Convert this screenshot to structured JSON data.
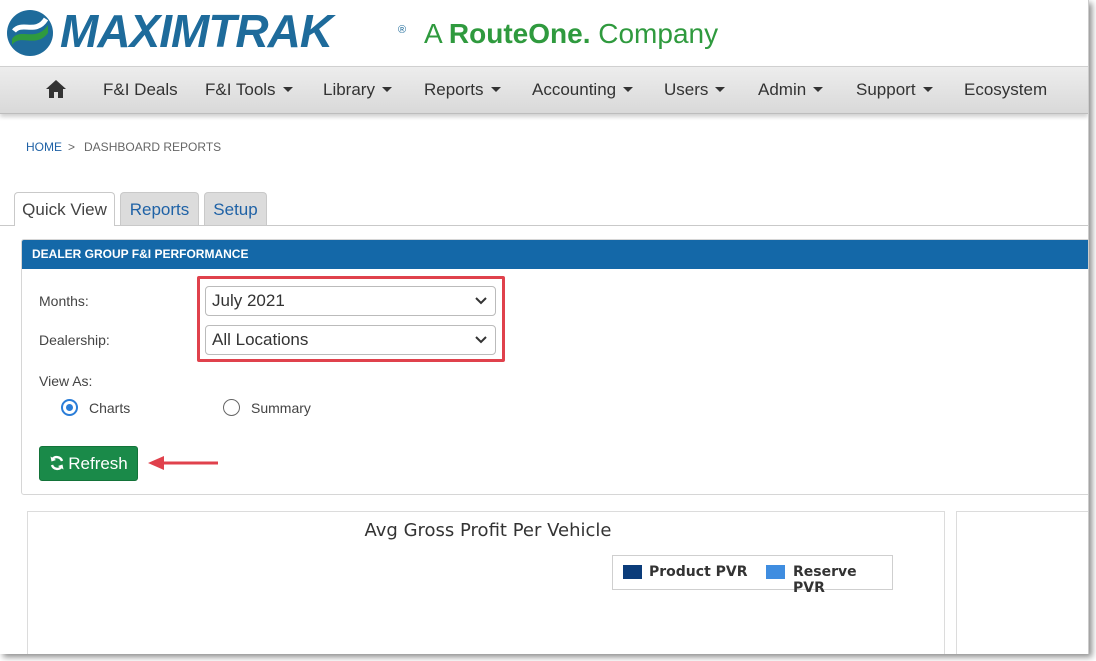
{
  "brand": {
    "name": "MAXIMTRAK",
    "registered": "®",
    "tagline_prefix": "A",
    "tagline_company": "RouteOne.",
    "tagline_suffix": "Company",
    "primary_color": "#1e6b9b",
    "accent_color": "#2f9a3e"
  },
  "nav": {
    "home_icon": "home-icon",
    "items": [
      {
        "label": "F&I Deals",
        "dropdown": false
      },
      {
        "label": "F&I Tools",
        "dropdown": true
      },
      {
        "label": "Library",
        "dropdown": true
      },
      {
        "label": "Reports",
        "dropdown": true
      },
      {
        "label": "Accounting",
        "dropdown": true
      },
      {
        "label": "Users",
        "dropdown": true
      },
      {
        "label": "Admin",
        "dropdown": true
      },
      {
        "label": "Support",
        "dropdown": true
      },
      {
        "label": "Ecosystem",
        "dropdown": false
      }
    ]
  },
  "breadcrumb": {
    "home": "HOME",
    "separator": ">",
    "current": "DASHBOARD REPORTS"
  },
  "tabs": [
    {
      "label": "Quick View",
      "active": true
    },
    {
      "label": "Reports",
      "active": false
    },
    {
      "label": "Setup",
      "active": false
    }
  ],
  "panel": {
    "title": "DEALER GROUP F&I PERFORMANCE",
    "header_color": "#1468a8",
    "months_label": "Months:",
    "months_value": "July 2021",
    "dealership_label": "Dealership:",
    "dealership_value": "All Locations",
    "view_as_label": "View As:",
    "view_options": [
      {
        "label": "Charts",
        "selected": true
      },
      {
        "label": "Summary",
        "selected": false
      }
    ],
    "refresh_label": "Refresh",
    "refresh_icon": "refresh-icon",
    "refresh_color": "#1a8a49"
  },
  "annotations": {
    "highlight_color": "#e0414c"
  },
  "chart_data": {
    "type": "bar",
    "title": "Avg Gross Profit Per Vehicle",
    "legend_position": "top-right",
    "series": [
      {
        "name": "Product PVR",
        "color": "#0b3c7a",
        "values": []
      },
      {
        "name": "Reserve PVR",
        "color": "#3f8de0",
        "values": []
      }
    ]
  }
}
